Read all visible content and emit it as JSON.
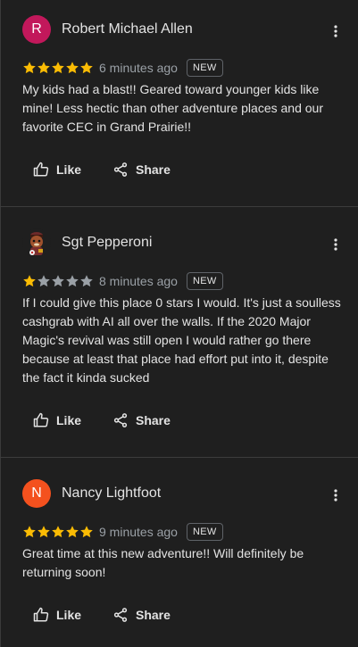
{
  "reviews": [
    {
      "avatar_letter": "R",
      "avatar_color": "#c2185b",
      "name": "Robert Michael Allen",
      "rating": 5,
      "time": "6 minutes ago",
      "badge": "NEW",
      "text": "My kids had a blast!! Geared toward younger kids like mine! Less hectic than other adventure places and our favorite CEC in Grand Prairie!!",
      "like_label": "Like",
      "share_label": "Share"
    },
    {
      "avatar_letter": "",
      "avatar_color": "#3a2a24",
      "name": "Sgt Pepperoni",
      "rating": 1,
      "time": "8 minutes ago",
      "badge": "NEW",
      "text": "If I could give this place 0 stars I would. It's just a soulless cashgrab with AI all over the walls. If the 2020 Major Magic's revival was still open I would rather go there because at least that place had effort put into it, despite the fact it kinda sucked",
      "like_label": "Like",
      "share_label": "Share"
    },
    {
      "avatar_letter": "N",
      "avatar_color": "#f4511e",
      "name": "Nancy Lightfoot",
      "rating": 5,
      "time": "9 minutes ago",
      "badge": "NEW",
      "text": "Great time at this new adventure!! Will definitely be returning soon!",
      "like_label": "Like",
      "share_label": "Share"
    }
  ],
  "colors": {
    "star_filled": "#fbbc04",
    "star_empty": "#9aa0a6"
  }
}
